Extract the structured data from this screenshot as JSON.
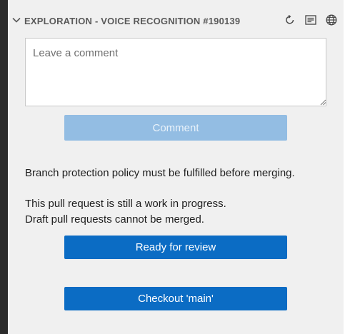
{
  "header": {
    "title": "EXPLORATION - VOICE RECOGNITION #190139",
    "icons": [
      "refresh-icon",
      "description-icon",
      "globe-icon"
    ]
  },
  "comment": {
    "placeholder": "Leave a comment",
    "value": "",
    "button_label": "Comment"
  },
  "status": {
    "branch_protection": "Branch protection policy must be fulfilled before merging.",
    "draft_line1": "This pull request is still a work in progress.",
    "draft_line2": "Draft pull requests cannot be merged."
  },
  "actions": {
    "ready_label": "Ready for review",
    "checkout_label": "Checkout 'main'"
  },
  "colors": {
    "primary": "#0b6cc4",
    "disabled_button": "#93bde3",
    "panel_bg": "#f0f0f0",
    "title": "#5a5a5a"
  }
}
